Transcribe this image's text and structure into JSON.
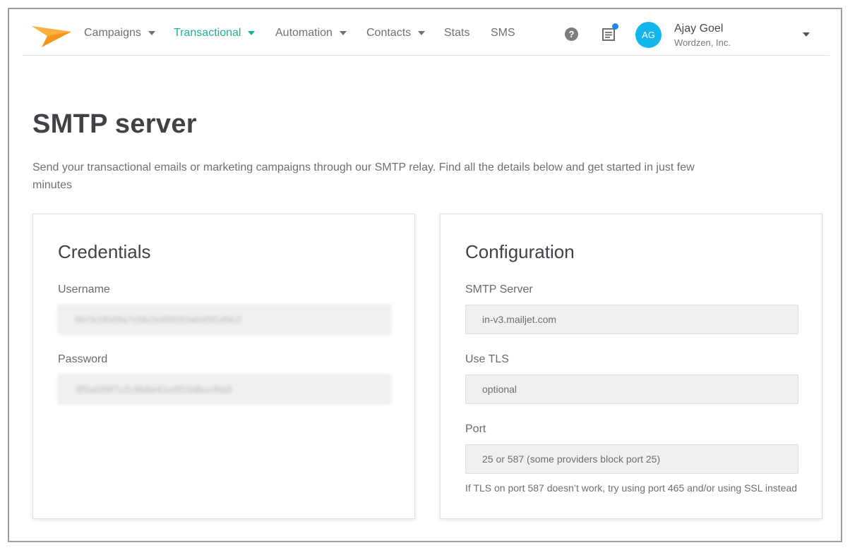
{
  "nav": {
    "items": [
      {
        "label": "Campaigns",
        "dropdown": true,
        "active": false
      },
      {
        "label": "Transactional",
        "dropdown": true,
        "active": true
      },
      {
        "label": "Automation",
        "dropdown": true,
        "active": false
      },
      {
        "label": "Contacts",
        "dropdown": true,
        "active": false
      },
      {
        "label": "Stats",
        "dropdown": false,
        "active": false
      },
      {
        "label": "SMS",
        "dropdown": false,
        "active": false
      }
    ],
    "help_icon": "question-circle-icon",
    "notes_icon": "document-icon",
    "user": {
      "initials": "AG",
      "name": "Ajay Goel",
      "company": "Wordzen, Inc."
    },
    "colors": {
      "active": "#1fb28f",
      "avatar": "#13b5ea",
      "logo": "#f7941d",
      "notification": "#1e88e5"
    }
  },
  "page": {
    "title": "SMTP server",
    "description": "Send your transactional emails or marketing campaigns through our SMTP relay. Find all the details below and get started in just few minutes"
  },
  "credentials": {
    "title": "Credentials",
    "username_label": "Username",
    "username_value": "8b7e1f0d9a7c5b2e4f9033a0d5f1d9c2",
    "password_label": "Password",
    "password_value": "3f5a0d9f7c2c8b6e41e0f10dbccf8a5"
  },
  "configuration": {
    "title": "Configuration",
    "server_label": "SMTP Server",
    "server_value": "in-v3.mailjet.com",
    "tls_label": "Use TLS",
    "tls_value": "optional",
    "port_label": "Port",
    "port_value": "25 or 587 (some providers block port 25)",
    "hint": "If TLS on port 587 doesn’t work, try using port 465 and/or using SSL instead"
  }
}
